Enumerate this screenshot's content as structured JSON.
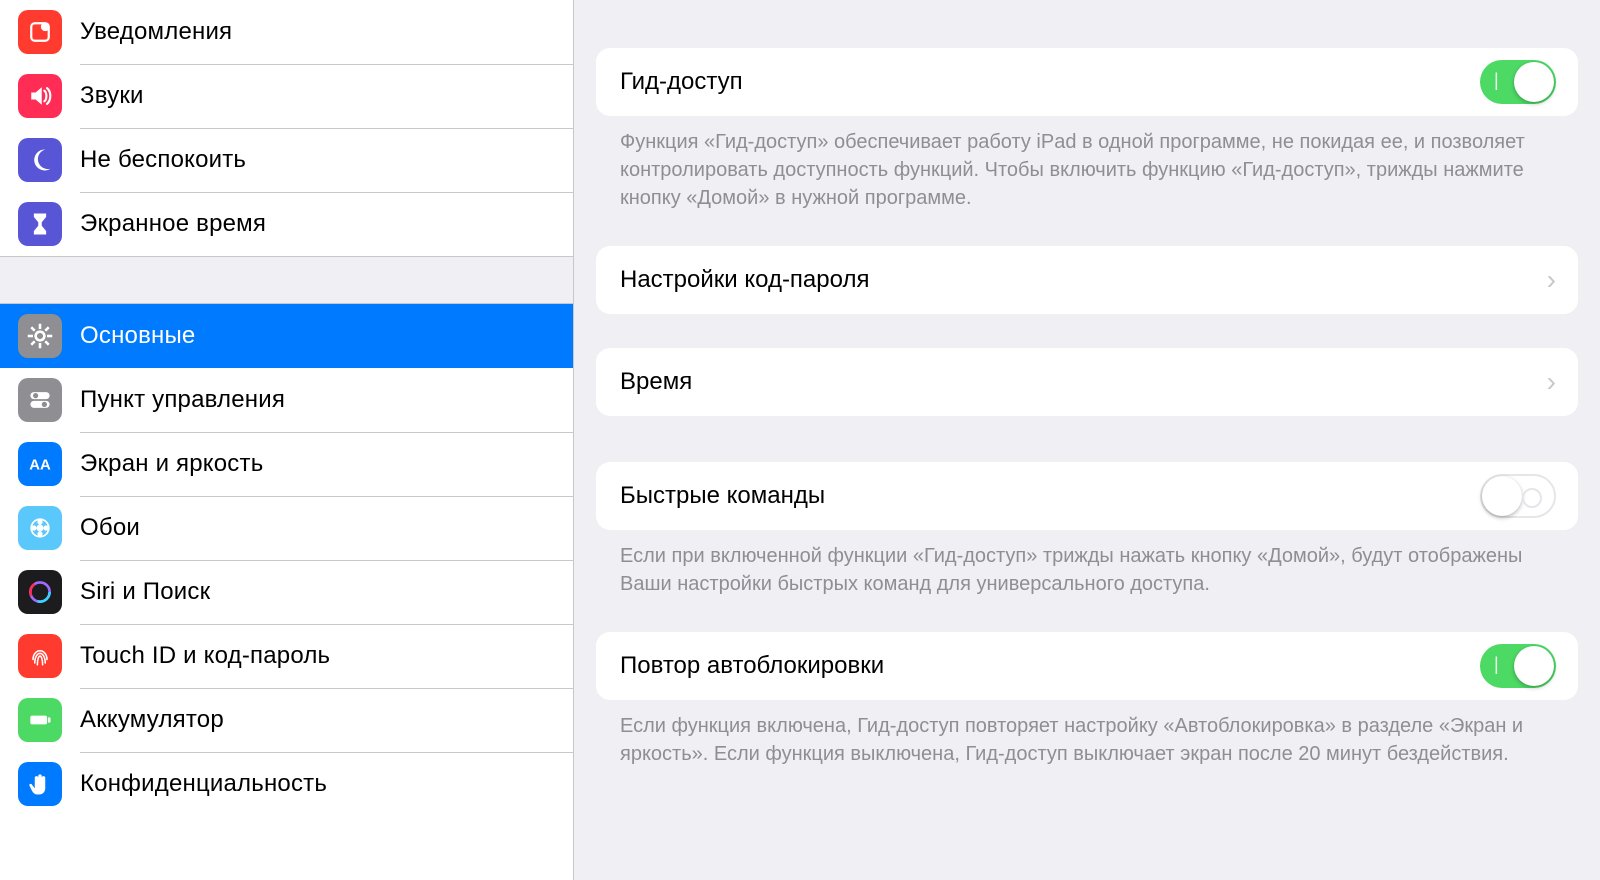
{
  "sidebar": {
    "group1": [
      {
        "label": "Уведомления"
      },
      {
        "label": "Звуки"
      },
      {
        "label": "Не беспокоить"
      },
      {
        "label": "Экранное время"
      }
    ],
    "group2": [
      {
        "label": "Основные"
      },
      {
        "label": "Пункт управления"
      },
      {
        "label": "Экран и яркость"
      },
      {
        "label": "Обои"
      },
      {
        "label": "Siri и Поиск"
      },
      {
        "label": "Touch ID и код-пароль"
      },
      {
        "label": "Аккумулятор"
      },
      {
        "label": "Конфиденциальность"
      }
    ]
  },
  "detail": {
    "guided_access": {
      "title": "Гид-доступ",
      "note": "Функция «Гид-доступ» обеспечивает работу iPad в одной программе, не покидая ее, и позволяет контролировать доступность функций. Чтобы включить функцию «Гид-доступ», трижды нажмите кнопку «Домой» в нужной программе."
    },
    "passcode": {
      "title": "Настройки код-пароля"
    },
    "time": {
      "title": "Время"
    },
    "shortcuts": {
      "title": "Быстрые команды",
      "note": "Если при включенной функции «Гид-доступ» трижды нажать кнопку «Домой», будут отображены Ваши настройки быстрых команд для универсального доступа."
    },
    "autolock": {
      "title": "Повтор автоблокировки",
      "note": "Если функция включена, Гид-доступ повторяет настройку «Автоблокировка» в разделе «Экран и яркость». Если функция выключена, Гид-доступ выключает экран после 20 минут бездействия."
    }
  }
}
